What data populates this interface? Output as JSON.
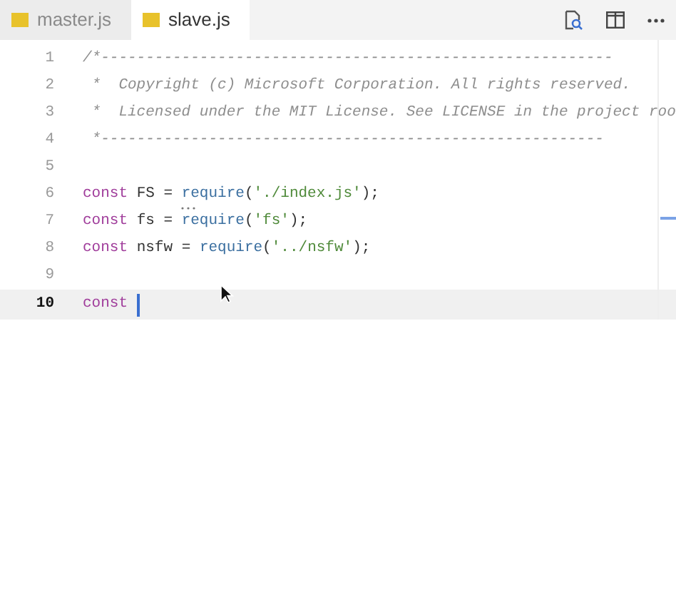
{
  "tabs": [
    {
      "label": "master.js",
      "selected": false
    },
    {
      "label": "slave.js",
      "selected": true
    }
  ],
  "editor": {
    "lines": [
      {
        "number": "1",
        "current": false,
        "tokens": [
          {
            "kind": "comment",
            "text": "/*---------------------------------------------------------"
          }
        ]
      },
      {
        "number": "2",
        "current": false,
        "tokens": [
          {
            "kind": "comment",
            "text": " *  Copyright (c) Microsoft Corporation. All rights reserved."
          }
        ]
      },
      {
        "number": "3",
        "current": false,
        "tokens": [
          {
            "kind": "comment",
            "text": " *  Licensed under the MIT License. See LICENSE in the project roo"
          }
        ]
      },
      {
        "number": "4",
        "current": false,
        "tokens": [
          {
            "kind": "comment",
            "text": " *--------------------------------------------------------"
          }
        ]
      },
      {
        "number": "5",
        "current": false
      },
      {
        "number": "6",
        "current": false,
        "tokens": [
          {
            "kind": "keyword",
            "text": "const"
          },
          {
            "kind": "plain",
            "text": " FS = "
          },
          {
            "kind": "function",
            "text": "require",
            "hint": true
          },
          {
            "kind": "plain",
            "text": "("
          },
          {
            "kind": "string",
            "text": "'./index.js'"
          },
          {
            "kind": "plain",
            "text": ");"
          }
        ]
      },
      {
        "number": "7",
        "current": false,
        "tokens": [
          {
            "kind": "keyword",
            "text": "const"
          },
          {
            "kind": "plain",
            "text": " fs = "
          },
          {
            "kind": "function",
            "text": "require"
          },
          {
            "kind": "plain",
            "text": "("
          },
          {
            "kind": "string",
            "text": "'fs'"
          },
          {
            "kind": "plain",
            "text": ");"
          }
        ]
      },
      {
        "number": "8",
        "current": false,
        "tokens": [
          {
            "kind": "keyword",
            "text": "const"
          },
          {
            "kind": "plain",
            "text": " nsfw = "
          },
          {
            "kind": "function",
            "text": "require"
          },
          {
            "kind": "plain",
            "text": "("
          },
          {
            "kind": "string",
            "text": "'../nsfw'"
          },
          {
            "kind": "plain",
            "text": ");"
          }
        ]
      },
      {
        "number": "9",
        "current": false
      },
      {
        "number": "10",
        "current": true,
        "tokens": [
          {
            "kind": "keyword",
            "text": "const"
          }
        ]
      }
    ]
  }
}
